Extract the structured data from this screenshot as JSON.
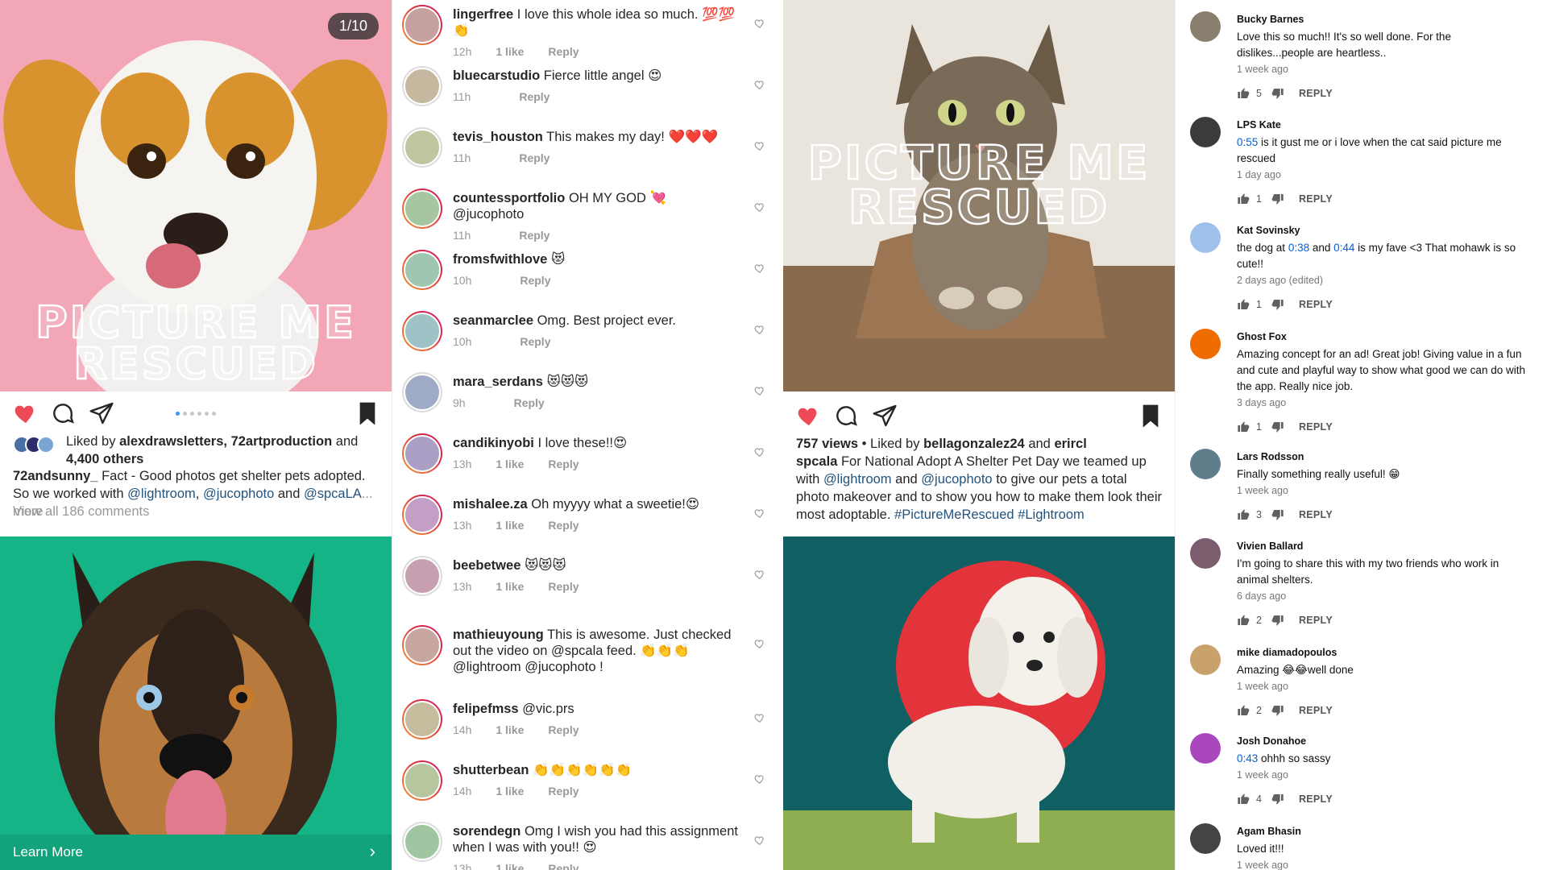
{
  "post1": {
    "counter": "1/10",
    "overlay_line1": "PICTURE ME",
    "overlay_line2": "RESCUED",
    "liked_prefix": "Liked by",
    "liked_user1": "alexdrawsletters",
    "liked_user2": "72artproduction",
    "liked_and": "and",
    "liked_others": "4,400 others",
    "caption_user": "72andsunny_",
    "caption_text": "Fact - Good photos get shelter pets adopted. So we worked with",
    "caption_tag1": "@lightroom",
    "caption_tag2": "@jucophoto",
    "caption_and": "and",
    "caption_tag3": "@spcaLA",
    "caption_more": "... more",
    "view_all": "View all 186 comments",
    "learn_more": "Learn More"
  },
  "comments_ig": [
    {
      "user": "lingerfree",
      "text": "I love this whole idea so much. 💯💯👏",
      "time": "12h",
      "likes": "1 like",
      "reply": "Reply",
      "ring": true
    },
    {
      "user": "bluecarstudio",
      "text": "Fierce little angel 😍",
      "time": "11h",
      "likes": "",
      "reply": "Reply",
      "ring": false
    },
    {
      "user": "tevis_houston",
      "text": "This makes my day! ❤️❤️❤️",
      "time": "11h",
      "likes": "",
      "reply": "Reply",
      "ring": false
    },
    {
      "user": "countessportfolio",
      "text": "OH MY GOD 💘 @jucophoto",
      "time": "11h",
      "likes": "",
      "reply": "Reply",
      "ring": true
    },
    {
      "user": "fromsfwithlove",
      "text": "😻",
      "time": "10h",
      "likes": "",
      "reply": "Reply",
      "ring": true
    },
    {
      "user": "seanmarclee",
      "text": "Omg. Best project ever.",
      "time": "10h",
      "likes": "",
      "reply": "Reply",
      "ring": true
    },
    {
      "user": "mara_serdans",
      "text": "😻😻😻",
      "time": "9h",
      "likes": "",
      "reply": "Reply",
      "ring": false
    },
    {
      "user": "candikinyobi",
      "text": "I love these!!😍",
      "time": "13h",
      "likes": "1 like",
      "reply": "Reply",
      "ring": true
    },
    {
      "user": "mishalee.za",
      "text": "Oh myyyy what a sweetie!😍",
      "time": "13h",
      "likes": "1 like",
      "reply": "Reply",
      "ring": true
    },
    {
      "user": "beebetwee",
      "text": "😻😻😻",
      "time": "13h",
      "likes": "1 like",
      "reply": "Reply",
      "ring": false
    },
    {
      "user": "mathieuyoung",
      "text": "This is awesome. Just checked out the video on @spcala feed. 👏👏👏 @lightroom @jucophoto !",
      "time": "",
      "likes": "",
      "reply": "",
      "ring": true
    },
    {
      "user": "felipefmss",
      "text": "@vic.prs",
      "time": "14h",
      "likes": "1 like",
      "reply": "Reply",
      "ring": true
    },
    {
      "user": "shutterbean",
      "text": "👏👏👏👏👏👏",
      "time": "14h",
      "likes": "1 like",
      "reply": "Reply",
      "ring": true
    },
    {
      "user": "sorendegn",
      "text": "Omg I wish you had this assignment when I was with you!! 😍",
      "time": "13h",
      "likes": "1 like",
      "reply": "Reply",
      "ring": false
    }
  ],
  "post2": {
    "overlay_line1": "PICTURE ME",
    "overlay_line2": "RESCUED",
    "views": "757 views",
    "liked_prefix": "• Liked by",
    "liked_user1": "bellagonzalez24",
    "liked_and": "and",
    "liked_user2": "erircl",
    "caption_user": "spcala",
    "caption_text1": "For National Adopt A Shelter Pet Day we teamed up with",
    "caption_tag1": "@lightroom",
    "caption_and": "and",
    "caption_tag2": "@jucophoto",
    "caption_text2": "to give our pets a total photo makeover and to show you how to make them look their most adoptable.",
    "caption_tag3": "#PictureMeRescued",
    "caption_tag4": "#Lightroom"
  },
  "comments_yt": [
    {
      "name": "Bucky Barnes",
      "text": "Love this so much!!  It's so well done.  For the dislikes...people are heartless..",
      "time": "1 week ago",
      "likes": "5",
      "reply": "REPLY",
      "avatar_color": "#8a7f6e"
    },
    {
      "name": "LPS Kate",
      "text_ts": "0:55",
      "text": " is it gust me or i love when the cat said picture me rescued",
      "time": "1 day ago",
      "likes": "1",
      "reply": "REPLY",
      "avatar_color": "#3b3b3b"
    },
    {
      "name": "Kat Sovinsky",
      "text_pre": "the dog at ",
      "text_ts": "0:38",
      "text_mid": " and ",
      "text_ts2": "0:44",
      "text": " is my fave <3 That mohawk is so cute!!",
      "time": "2 days ago (edited)",
      "likes": "1",
      "reply": "REPLY",
      "avatar_color": "#9fc0e8"
    },
    {
      "name": "Ghost Fox",
      "text": "Amazing concept for an ad! Great job! Giving value in a fun and cute and  playful way to show what good we can do with the app. Really nice job.",
      "time": "3 days ago",
      "likes": "1",
      "reply": "REPLY",
      "avatar_color": "#ef6c00"
    },
    {
      "name": "Lars Rodsson",
      "text": "Finally something really useful! 😁",
      "time": "1 week ago",
      "likes": "3",
      "reply": "REPLY",
      "avatar_color": "#607d8b"
    },
    {
      "name": "Vivien Ballard",
      "text": "I'm going to share this with my two friends who work in animal shelters.",
      "time": "6 days ago",
      "likes": "2",
      "reply": "REPLY",
      "avatar_color": "#7b5d6e"
    },
    {
      "name": "mike diamadopoulos",
      "text": "Amazing 😂😂well done",
      "time": "1 week ago",
      "likes": "2",
      "reply": "REPLY",
      "avatar_color": "#c9a26b"
    },
    {
      "name": "Josh Donahoe",
      "text_ts": "0:43",
      "text": " ohhh so sassy",
      "time": "1 week ago",
      "likes": "4",
      "reply": "REPLY",
      "avatar_color": "#ab47bc"
    },
    {
      "name": "Agam Bhasin",
      "text": "Loved it!!!",
      "time": "1 week ago",
      "likes": "",
      "reply": "",
      "avatar_color": "#444444"
    }
  ],
  "colors": {
    "heart_red": "#ed4956",
    "link_blue": "#24537c",
    "yt_ts_blue": "#065fd4",
    "cta_green": "#12a37a"
  }
}
